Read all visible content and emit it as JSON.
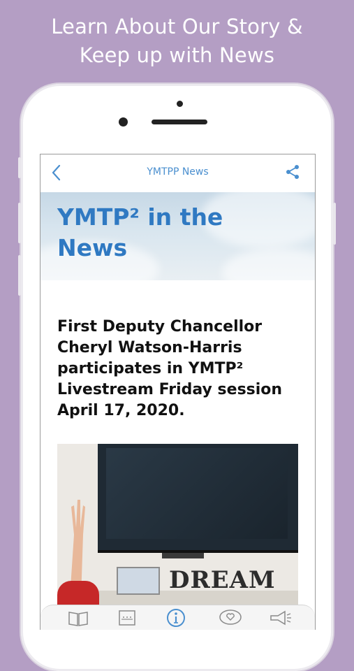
{
  "promo": {
    "line1": "Learn About Our Story &",
    "line2": "Keep up with News"
  },
  "navbar": {
    "title": "YMTPP News",
    "back_icon": "chevron-left-icon",
    "share_icon": "share-icon"
  },
  "hero": {
    "title_line1": "YMTP² in the",
    "title_line2": "News"
  },
  "article": {
    "title": "First Deputy Chancellor Cheryl Watson-Harris participates in YMTP² Livestream Friday session April 17, 2020.",
    "image_text": "DREAM"
  },
  "tabs": [
    {
      "icon": "book-icon",
      "active": false
    },
    {
      "icon": "abc-icon",
      "active": false
    },
    {
      "icon": "info-icon",
      "active": true
    },
    {
      "icon": "heart-chat-icon",
      "active": false
    },
    {
      "icon": "megaphone-icon",
      "active": false
    }
  ],
  "colors": {
    "background": "#b49ec4",
    "accent": "#4a8fcf",
    "hero_title": "#2f79c2"
  }
}
